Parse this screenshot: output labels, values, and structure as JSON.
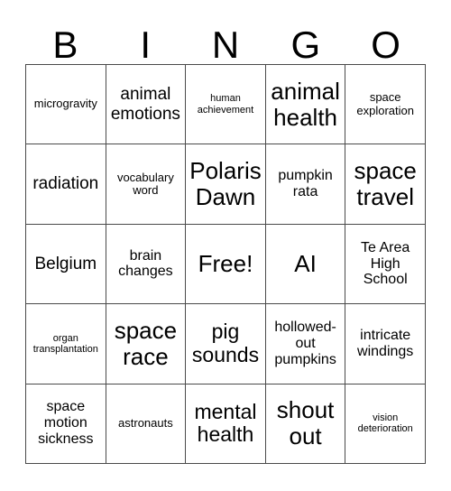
{
  "card": {
    "title": "BINGO",
    "header_letters": [
      "B",
      "I",
      "N",
      "G",
      "O"
    ],
    "grid_size": "5x5",
    "free_space_label": "Free!",
    "colors": {
      "background": "#ffffff",
      "text": "#000000",
      "grid_line": "#4a4a4a"
    },
    "rows": [
      [
        {
          "text": "microgravity",
          "size": "sm"
        },
        {
          "text": "animal emotions",
          "size": "lg"
        },
        {
          "text": "human achievement",
          "size": "xs"
        },
        {
          "text": "animal health",
          "size": "xxl"
        },
        {
          "text": "space exploration",
          "size": "sm"
        }
      ],
      [
        {
          "text": "radiation",
          "size": "lg"
        },
        {
          "text": "vocabulary word",
          "size": "sm"
        },
        {
          "text": "Polaris Dawn",
          "size": "xxl"
        },
        {
          "text": "pumpkin rata",
          "size": "md"
        },
        {
          "text": "space travel",
          "size": "xxl"
        }
      ],
      [
        {
          "text": "Belgium",
          "size": "lg"
        },
        {
          "text": "brain changes",
          "size": "md"
        },
        {
          "text": "Free!",
          "size": "xxl"
        },
        {
          "text": "AI",
          "size": "xxl"
        },
        {
          "text": "Te Area High School",
          "size": "md"
        }
      ],
      [
        {
          "text": "organ transplantation",
          "size": "xs"
        },
        {
          "text": "space race",
          "size": "xxl"
        },
        {
          "text": "pig sounds",
          "size": "xl"
        },
        {
          "text": "hollowed-out pumpkins",
          "size": "md"
        },
        {
          "text": "intricate windings",
          "size": "md"
        }
      ],
      [
        {
          "text": "space motion sickness",
          "size": "md"
        },
        {
          "text": "astronauts",
          "size": "sm"
        },
        {
          "text": "mental health",
          "size": "xl"
        },
        {
          "text": "shout out",
          "size": "xxl"
        },
        {
          "text": "vision deterioration",
          "size": "xs"
        }
      ]
    ]
  }
}
